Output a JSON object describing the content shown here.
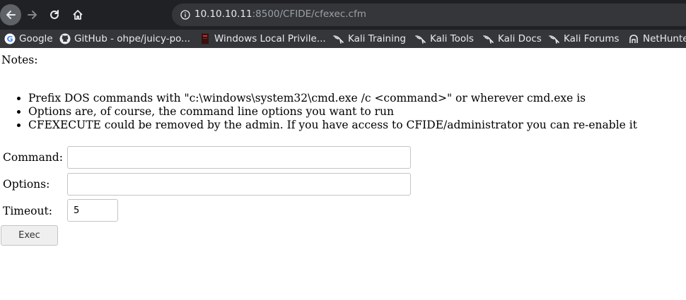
{
  "browser": {
    "url": {
      "host": "10.10.10.11",
      "rest": ":8500/CFIDE/cfexec.cfm"
    },
    "bookmarks": [
      {
        "label": "Google",
        "icon": "google-icon"
      },
      {
        "label": "GitHub - ohpe/juicy-po...",
        "icon": "github-icon"
      },
      {
        "label": "Windows Local Privile...",
        "icon": "bookmark-page-icon"
      },
      {
        "label": "Kali Training",
        "icon": "kali-dragon-icon"
      },
      {
        "label": "Kali Tools",
        "icon": "kali-dragon-icon"
      },
      {
        "label": "Kali Docs",
        "icon": "kali-dragon-icon"
      },
      {
        "label": "Kali Forums",
        "icon": "kali-dragon-icon"
      },
      {
        "label": "NetHunter",
        "icon": "nethunter-icon"
      }
    ]
  },
  "page": {
    "notes_label": "Notes:",
    "notes": [
      "Prefix DOS commands with \"c:\\windows\\system32\\cmd.exe /c <command>\" or wherever cmd.exe is",
      "Options are, of course, the command line options you want to run",
      "CFEXECUTE could be removed by the admin. If you have access to CFIDE/administrator you can re-enable it"
    ],
    "form": {
      "command_label": "Command:",
      "command_value": "",
      "options_label": "Options:",
      "options_value": "",
      "timeout_label": "Timeout:",
      "timeout_value": "5",
      "exec_label": "Exec"
    }
  },
  "colors": {
    "toolbar": "#202124",
    "omnibox": "#35363a",
    "bookmarks_bar": "#35363a",
    "text_light": "#e8eaed",
    "text_muted": "#9aa0a6"
  }
}
